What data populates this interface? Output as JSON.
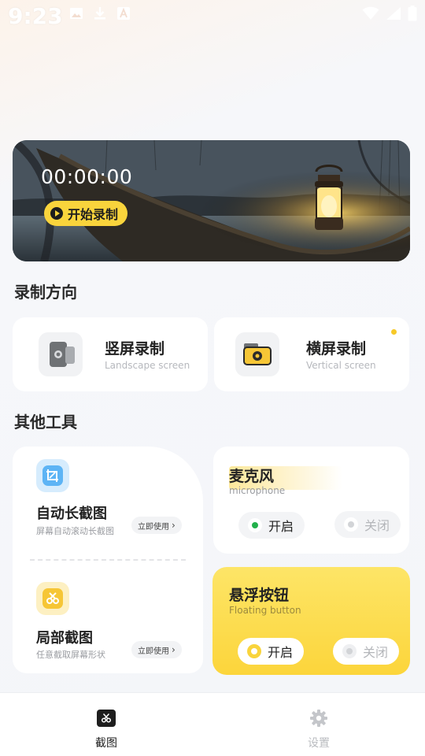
{
  "status_bar": {
    "time": "9:23",
    "left_icons": [
      "image-icon",
      "download-icon",
      "a-icon"
    ],
    "right_icons": [
      "wifi-icon",
      "signal-icon",
      "battery-icon"
    ]
  },
  "hero": {
    "timer": "00:00:00",
    "record_label": "开始录制"
  },
  "orientation": {
    "section_title": "录制方向",
    "portrait": {
      "title": "竖屏录制",
      "subtitle": "Landscape screen"
    },
    "landscape": {
      "title": "横屏录制",
      "subtitle": "Vertical screen"
    }
  },
  "tools": {
    "section_title": "其他工具",
    "long_screenshot": {
      "title": "自动长截图",
      "subtitle": "屏幕自动滚动长截图",
      "action": "立即使用"
    },
    "partial_screenshot": {
      "title": "局部截图",
      "subtitle": "任意截取屏幕形状",
      "action": "立即使用"
    }
  },
  "microphone": {
    "title": "麦克风",
    "subtitle": "microphone",
    "on_label": "开启",
    "off_label": "关闭",
    "selected": "on"
  },
  "floating_button": {
    "title": "悬浮按钮",
    "subtitle": "Floating button",
    "on_label": "开启",
    "off_label": "关闭",
    "selected": "on"
  },
  "nav": {
    "items": [
      {
        "label": "截图",
        "icon": "screenshot-icon",
        "active": true
      },
      {
        "label": "设置",
        "icon": "gear-icon",
        "active": false
      }
    ]
  },
  "colors": {
    "accent_yellow": "#f9d43c",
    "mic_on_dot": "#22b04b",
    "nav_active": "#1e1e1e",
    "nav_inactive": "#b9bbbf"
  }
}
